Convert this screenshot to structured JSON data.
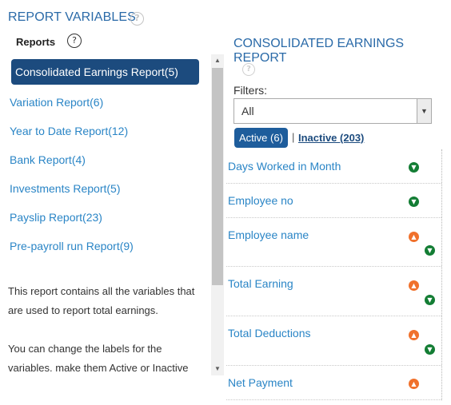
{
  "header": {
    "title": "REPORT VARIABLES",
    "help_icon": "?"
  },
  "reports": {
    "label": "Reports",
    "help_icon": "?",
    "items": [
      {
        "label": "Consolidated Earnings Report(5)",
        "active": true
      },
      {
        "label": "Variation Report(6)"
      },
      {
        "label": "Year to Date Report(12)"
      },
      {
        "label": "Bank Report(4)"
      },
      {
        "label": "Investments Report(5)"
      },
      {
        "label": "Payslip Report(23)"
      },
      {
        "label": "Pre-payroll run Report(9)"
      }
    ]
  },
  "description": {
    "p1": "This report contains all the variables that are used to report total earnings.",
    "p2": "You can change the labels for the variables. make them Active or Inactive"
  },
  "detail": {
    "title": "CONSOLIDATED EARNINGS REPORT",
    "help_icon": "?",
    "filters_label": "Filters:",
    "filter_value": "All",
    "tab_active": "Active (6)",
    "tab_separator": "|",
    "tab_inactive": "Inactive (203)",
    "variables": [
      {
        "label": "Days Worked in Month",
        "arrows": [
          "down"
        ]
      },
      {
        "label": "Employee no",
        "arrows": [
          "down"
        ]
      },
      {
        "label": "Employee name",
        "arrows": [
          "up",
          "down"
        ]
      },
      {
        "label": "Total Earning",
        "arrows": [
          "up",
          "down"
        ]
      },
      {
        "label": "Total Deductions",
        "arrows": [
          "up",
          "down"
        ]
      },
      {
        "label": "Net Payment",
        "arrows": [
          "up"
        ]
      }
    ]
  },
  "colors": {
    "accent": "#2a6aa8",
    "link": "#2a85c6",
    "active_bg": "#1c4b7e",
    "move_down": "#137d34",
    "move_up": "#f0712c"
  }
}
